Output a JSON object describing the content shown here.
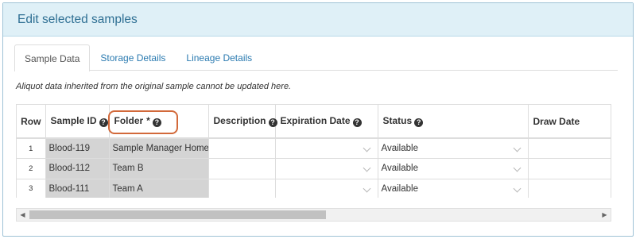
{
  "panel": {
    "title": "Edit selected samples"
  },
  "tabs": [
    {
      "label": "Sample Data",
      "active": true
    },
    {
      "label": "Storage Details",
      "active": false
    },
    {
      "label": "Lineage Details",
      "active": false
    }
  ],
  "notice": "Aliquot data inherited from the original sample cannot be updated here.",
  "grid": {
    "columns": {
      "row": "Row",
      "sample_id": "Sample ID",
      "folder": "Folder",
      "folder_required": "*",
      "description": "Description",
      "expiration_date": "Expiration Date",
      "status": "Status",
      "draw_date": "Draw Date"
    },
    "help_glyph": "?",
    "rows": [
      {
        "row": "1",
        "sample_id": "Blood-119",
        "folder": "Sample Manager Home",
        "description": "",
        "expiration_date": "",
        "status": "Available",
        "draw_date": ""
      },
      {
        "row": "2",
        "sample_id": "Blood-112",
        "folder": "Team B",
        "description": "",
        "expiration_date": "",
        "status": "Available",
        "draw_date": ""
      },
      {
        "row": "3",
        "sample_id": "Blood-111",
        "folder": "Team A",
        "description": "",
        "expiration_date": "",
        "status": "Available",
        "draw_date": ""
      }
    ]
  },
  "scrollbar": {
    "left_arrow": "◀",
    "right_arrow": "▶"
  },
  "icons": {
    "help": "question-circle-icon",
    "select": "chevron-down-icon"
  },
  "colors": {
    "accent": "#2e6f93",
    "highlight": "#d2693a",
    "readonly_cell": "#d4d4d4"
  }
}
